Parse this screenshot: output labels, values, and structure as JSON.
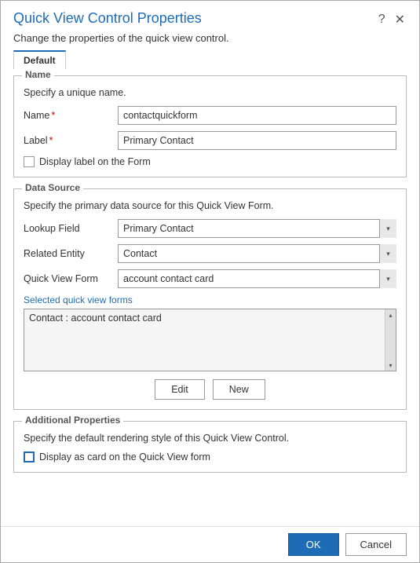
{
  "dialog": {
    "title": "Quick View Control Properties",
    "subtitle": "Change the properties of the quick view control.",
    "help_icon": "?",
    "close_icon": "✕"
  },
  "tabs": [
    {
      "label": "Default",
      "active": true
    }
  ],
  "name_section": {
    "legend": "Name",
    "description": "Specify a unique name.",
    "name_label": "Name",
    "name_required": true,
    "name_value": "contactquickform",
    "label_label": "Label",
    "label_required": true,
    "label_value": "Primary Contact",
    "checkbox_label": "Display label on the Form",
    "checkbox_checked": false
  },
  "datasource_section": {
    "legend": "Data Source",
    "description": "Specify the primary data source for this Quick View Form.",
    "lookup_field_label": "Lookup Field",
    "lookup_field_value": "Primary Contact",
    "lookup_options": [
      "Primary Contact"
    ],
    "related_entity_label": "Related Entity",
    "related_entity_value": "Contact",
    "related_options": [
      "Contact"
    ],
    "quick_view_form_label": "Quick View Form",
    "quick_view_form_value": "account contact card",
    "quick_view_options": [
      "account contact card"
    ],
    "selected_label": "Selected quick view forms",
    "selected_items": [
      "Contact : account contact card"
    ],
    "edit_button": "Edit",
    "new_button": "New"
  },
  "additional_section": {
    "legend": "Additional Properties",
    "description": "Specify the default rendering style of this Quick View Control.",
    "card_checkbox_label": "Display as card on the Quick View form",
    "card_checked": false
  },
  "footer": {
    "ok_label": "OK",
    "cancel_label": "Cancel"
  }
}
